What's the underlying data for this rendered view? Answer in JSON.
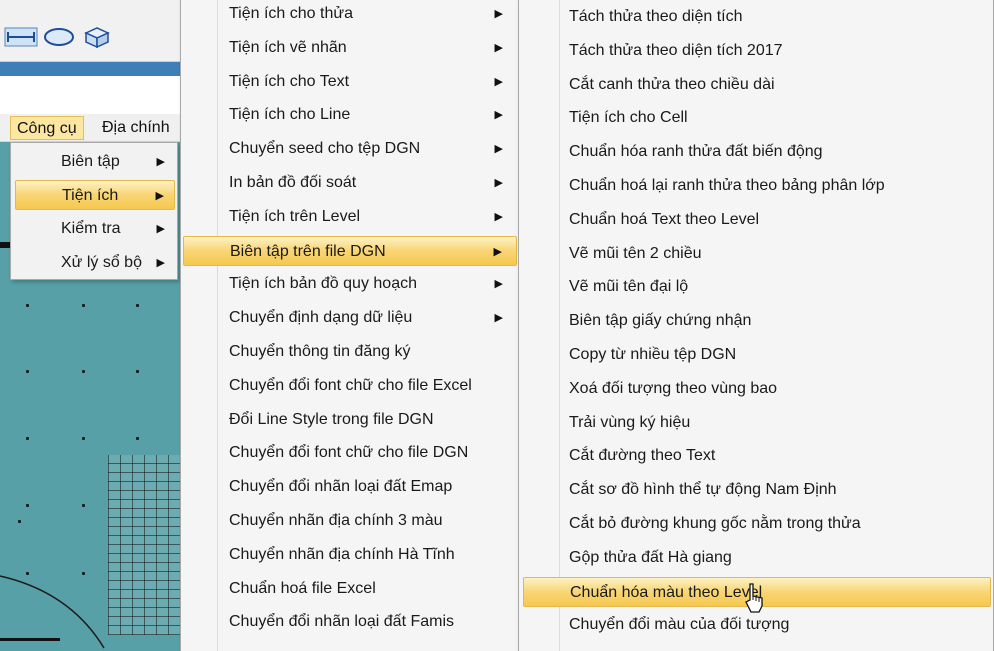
{
  "app": {
    "menubar": [
      {
        "label": "Công cụ",
        "active": true
      },
      {
        "label": "Địa chính",
        "active": false
      }
    ],
    "toolbar_icons": [
      "dimension-tool-icon",
      "ellipse-tool-icon",
      "box-3d-tool-icon"
    ]
  },
  "menu_cong_cu": {
    "items": [
      {
        "label": "Biên tập",
        "submenu": true
      },
      {
        "label": "Tiện ích",
        "submenu": true,
        "highlighted": true
      },
      {
        "label": "Kiểm tra",
        "submenu": true
      },
      {
        "label": "Xử lý sổ bộ",
        "submenu": true
      }
    ]
  },
  "menu_tien_ich": {
    "items": [
      {
        "label": "Tiện ích cho thửa",
        "submenu": true
      },
      {
        "label": "Tiện ích vẽ nhãn",
        "submenu": true
      },
      {
        "label": "Tiện ích cho Text",
        "submenu": true
      },
      {
        "label": "Tiện ích cho Line",
        "submenu": true
      },
      {
        "label": "Chuyển seed cho tệp DGN",
        "submenu": true
      },
      {
        "label": "In bản đồ đối soát",
        "submenu": true
      },
      {
        "label": "Tiện ích trên Level",
        "submenu": true
      },
      {
        "label": "Biên tập trên file DGN",
        "submenu": true,
        "highlighted": true
      },
      {
        "label": "Tiện ích bản đồ quy hoạch",
        "submenu": true
      },
      {
        "label": "Chuyển định dạng dữ liệu",
        "submenu": true
      },
      {
        "label": "Chuyển thông tin đăng ký",
        "submenu": false
      },
      {
        "label": "Chuyển đổi font chữ cho file Excel",
        "submenu": false
      },
      {
        "label": "Đổi Line Style trong file DGN",
        "submenu": false
      },
      {
        "label": "Chuyển đổi font chữ cho file DGN",
        "submenu": false
      },
      {
        "label": "Chuyển đổi nhãn loại đất Emap",
        "submenu": false
      },
      {
        "label": "Chuyển nhãn địa chính 3 màu",
        "submenu": false
      },
      {
        "label": "Chuyển nhãn địa chính Hà Tĩnh",
        "submenu": false
      },
      {
        "label": "Chuẩn hoá file Excel",
        "submenu": false
      },
      {
        "label": "Chuyển đổi nhãn loại đất Famis",
        "submenu": false
      }
    ]
  },
  "menu_bien_tap_dgn": {
    "items": [
      {
        "label": "Tách thửa theo diện tích"
      },
      {
        "label": "Tách thửa theo diện tích 2017"
      },
      {
        "label": "Cắt canh thửa theo chiều dài"
      },
      {
        "label": "Tiện ích cho Cell"
      },
      {
        "label": "Chuẩn hóa ranh thửa đất biến động"
      },
      {
        "label": "Chuẩn hoá lại ranh thửa theo bảng phân lớp"
      },
      {
        "label": "Chuẩn hoá Text theo Level"
      },
      {
        "label": "Vẽ mũi tên 2 chiều"
      },
      {
        "label": "Vẽ mũi tên đại lộ"
      },
      {
        "label": "Biên tập giấy chứng nhận"
      },
      {
        "label": "Copy từ nhiều tệp DGN"
      },
      {
        "label": "Xoá đối tượng theo vùng bao"
      },
      {
        "label": "Trải vùng ký hiệu"
      },
      {
        "label": "Cắt đường theo Text"
      },
      {
        "label": "Cắt sơ đồ hình thể tự động Nam Định"
      },
      {
        "label": "Cắt bỏ đường khung gốc nằm trong thửa"
      },
      {
        "label": "Gộp thửa đất Hà giang"
      },
      {
        "label": "Chuẩn hóa màu theo Level",
        "highlighted": true
      },
      {
        "label": "Chuyển đổi màu của đối tượng"
      }
    ]
  },
  "colors": {
    "highlight": "#f8d574",
    "menu_bg": "#f5f5f5",
    "canvas": "#58a0a7"
  }
}
